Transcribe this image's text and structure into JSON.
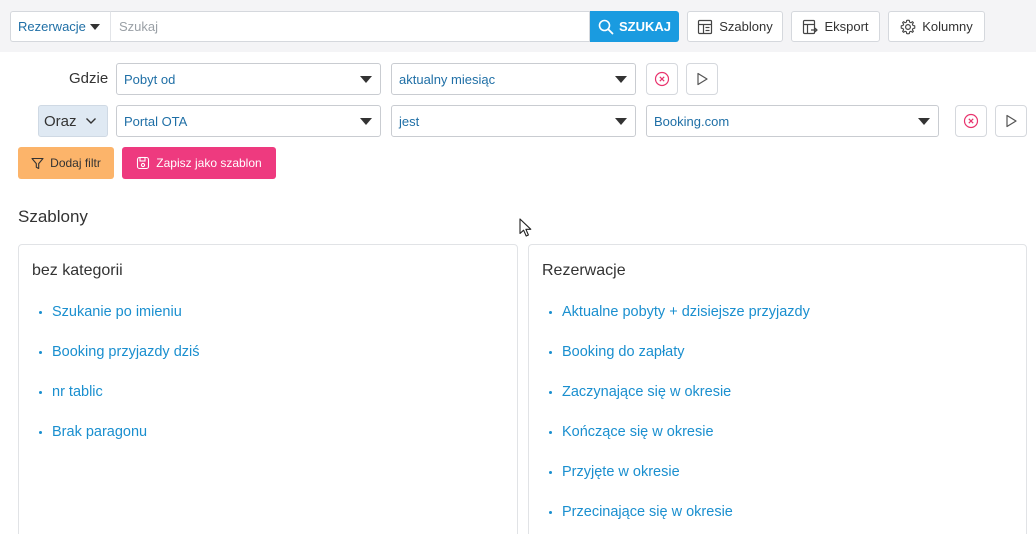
{
  "topbar": {
    "scope_select": "Rezerwacje",
    "search_placeholder": "Szukaj",
    "search_button": "SZUKAJ",
    "templates_button": "Szablony",
    "export_button": "Eksport",
    "columns_button": "Kolumny"
  },
  "filters": {
    "row1": {
      "label": "Gdzie",
      "field": "Pobyt od",
      "operator": "aktualny miesiąc"
    },
    "row2": {
      "conjunction": "Oraz",
      "field": "Portal OTA",
      "operator": "jest",
      "value": "Booking.com"
    },
    "add_filter_button": "Dodaj filtr",
    "save_template_button": "Zapisz jako szablon"
  },
  "templates_section": {
    "title": "Szablony",
    "categories": [
      {
        "title": "bez kategorii",
        "items": [
          "Szukanie po imieniu",
          "Booking przyjazdy dziś",
          "nr tablic",
          "Brak paragonu"
        ]
      },
      {
        "title": "Rezerwacje",
        "items": [
          "Aktualne pobyty + dzisiejsze przyjazdy",
          "Booking do zapłaty",
          "Zaczynające się w okresie",
          "Kończące się w okresie",
          "Przyjęte w okresie",
          "Przecinające się w okresie"
        ]
      }
    ]
  },
  "colors": {
    "accent": "#1a9be0",
    "link": "#1a8fcf",
    "add_filter": "#fcb46a",
    "save_template": "#ee3a7f",
    "clear_icon": "#e8336d"
  }
}
